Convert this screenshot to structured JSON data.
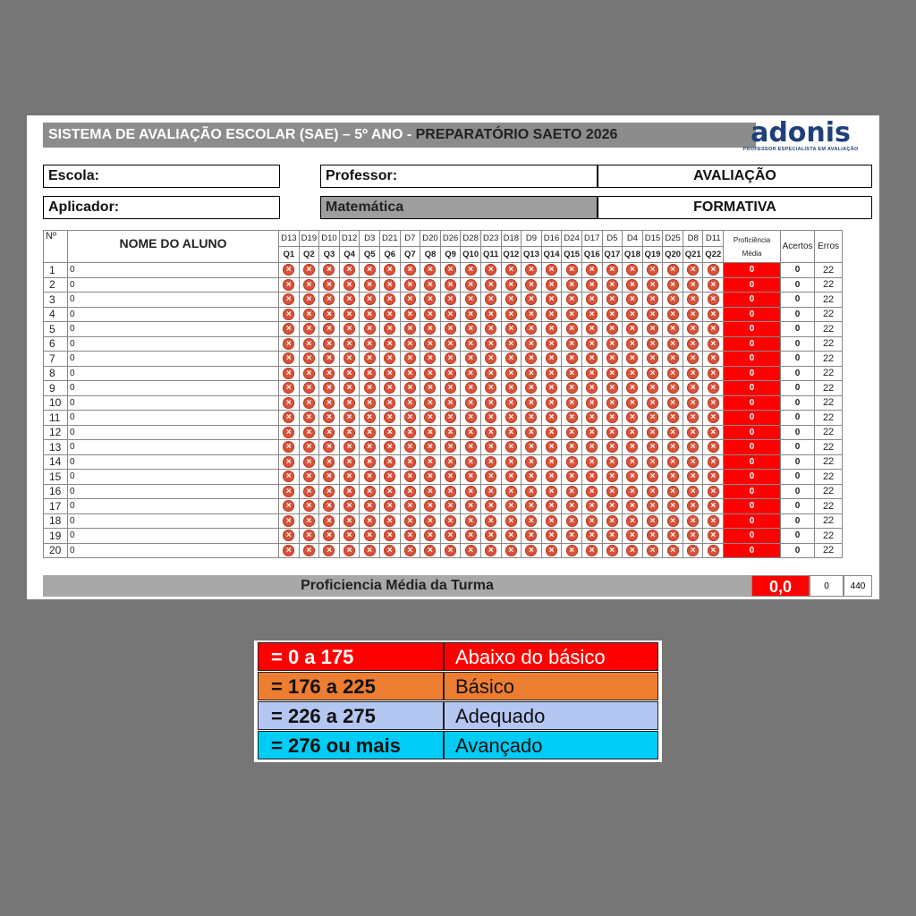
{
  "header": {
    "title_light": "SISTEMA DE AVALIAÇÃO ESCOLAR (SAE) – 5º ANO - ",
    "title_dark": "PREPARATÓRIO SAETO 2026",
    "logo_text": "adonis",
    "logo_subtitle": "PROFESSOR ESPECIALISTA EM AVALIAÇÃO"
  },
  "info": {
    "escola_label": "Escola:",
    "professor_label": "Professor:",
    "avaliacao_label": "AVALIAÇÃO",
    "aplicador_label": "Aplicador:",
    "disciplina": "Matemática",
    "formativa_label": "FORMATIVA"
  },
  "table": {
    "num_header": "Nº",
    "name_header": "NOME DO ALUNO",
    "descriptors": [
      "D13",
      "D19",
      "D10",
      "D12",
      "D3",
      "D21",
      "D7",
      "D20",
      "D26",
      "D28",
      "D23",
      "D18",
      "D9",
      "D16",
      "D24",
      "D17",
      "D5",
      "D4",
      "D15",
      "D25",
      "D8",
      "D11"
    ],
    "questions": [
      "Q1",
      "Q2",
      "Q3",
      "Q4",
      "Q5",
      "Q6",
      "Q7",
      "Q8",
      "Q9",
      "Q10",
      "Q11",
      "Q12",
      "Q13",
      "Q14",
      "Q15",
      "Q16",
      "Q17",
      "Q18",
      "Q19",
      "Q20",
      "Q21",
      "Q22"
    ],
    "prof_header_line1": "Proficiência",
    "prof_header_line2": "Média",
    "acertos_header": "Acertos",
    "erros_header": "Erros",
    "answer_icon": "x-circle-icon",
    "answer_color": "#d9533a",
    "prof_color": "#ff0000",
    "rows": [
      {
        "n": "1",
        "name": "0",
        "prof": "0",
        "acertos": "0",
        "erros": "22"
      },
      {
        "n": "2",
        "name": "0",
        "prof": "0",
        "acertos": "0",
        "erros": "22"
      },
      {
        "n": "3",
        "name": "0",
        "prof": "0",
        "acertos": "0",
        "erros": "22"
      },
      {
        "n": "4",
        "name": "0",
        "prof": "0",
        "acertos": "0",
        "erros": "22"
      },
      {
        "n": "5",
        "name": "0",
        "prof": "0",
        "acertos": "0",
        "erros": "22"
      },
      {
        "n": "6",
        "name": "0",
        "prof": "0",
        "acertos": "0",
        "erros": "22"
      },
      {
        "n": "7",
        "name": "0",
        "prof": "0",
        "acertos": "0",
        "erros": "22"
      },
      {
        "n": "8",
        "name": "0",
        "prof": "0",
        "acertos": "0",
        "erros": "22"
      },
      {
        "n": "9",
        "name": "0",
        "prof": "0",
        "acertos": "0",
        "erros": "22"
      },
      {
        "n": "10",
        "name": "0",
        "prof": "0",
        "acertos": "0",
        "erros": "22"
      },
      {
        "n": "11",
        "name": "0",
        "prof": "0",
        "acertos": "0",
        "erros": "22"
      },
      {
        "n": "12",
        "name": "0",
        "prof": "0",
        "acertos": "0",
        "erros": "22"
      },
      {
        "n": "13",
        "name": "0",
        "prof": "0",
        "acertos": "0",
        "erros": "22"
      },
      {
        "n": "14",
        "name": "0",
        "prof": "0",
        "acertos": "0",
        "erros": "22"
      },
      {
        "n": "15",
        "name": "0",
        "prof": "0",
        "acertos": "0",
        "erros": "22"
      },
      {
        "n": "16",
        "name": "0",
        "prof": "0",
        "acertos": "0",
        "erros": "22"
      },
      {
        "n": "17",
        "name": "0",
        "prof": "0",
        "acertos": "0",
        "erros": "22"
      },
      {
        "n": "18",
        "name": "0",
        "prof": "0",
        "acertos": "0",
        "erros": "22"
      },
      {
        "n": "19",
        "name": "0",
        "prof": "0",
        "acertos": "0",
        "erros": "22"
      },
      {
        "n": "20",
        "name": "0",
        "prof": "0",
        "acertos": "0",
        "erros": "22"
      }
    ]
  },
  "footer": {
    "label": "Proficiencia Média da Turma",
    "value": "0,0",
    "acertos_total": "0",
    "erros_total": "440"
  },
  "legend": [
    {
      "range": "= 0 a 175",
      "level": "Abaixo do básico",
      "bg": "#ff0000",
      "color": "#ffffff"
    },
    {
      "range": "= 176 a 225",
      "level": "Básico",
      "bg": "#ed7d31",
      "color": "#111111"
    },
    {
      "range": "= 226 a 275",
      "level": "Adequado",
      "bg": "#b4c7f2",
      "color": "#111111"
    },
    {
      "range": "= 276 ou mais",
      "level": "Avançado",
      "bg": "#00ccf5",
      "color": "#111111"
    }
  ]
}
